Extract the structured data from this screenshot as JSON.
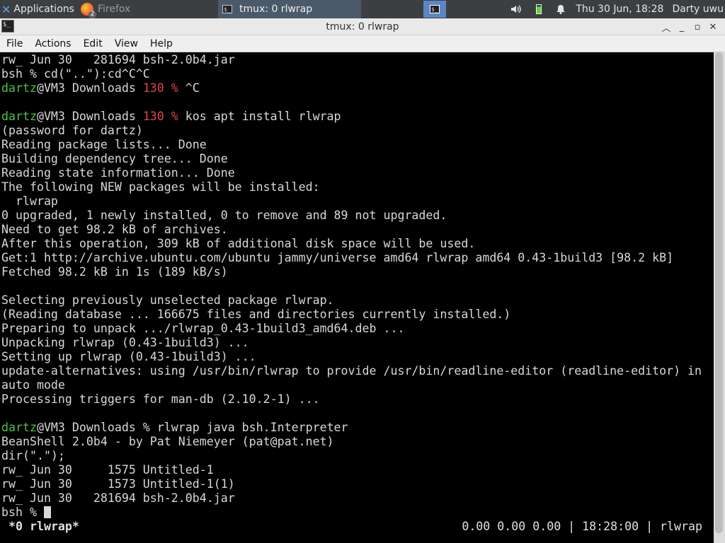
{
  "panel": {
    "apps_label": "Applications",
    "firefox_label": "Firefox",
    "firefox_badge": "2",
    "tmux_task_label": "tmux: 0 rlwrap",
    "clock": "Thu 30 Jun, 18:28",
    "user": "Darty uwu"
  },
  "window": {
    "title": "tmux: 0 rlwrap"
  },
  "menu": {
    "file": "File",
    "actions": "Actions",
    "edit": "Edit",
    "view": "View",
    "help": "Help"
  },
  "terminal": {
    "line1": "rw_ Jun 30   281694 bsh-2.0b4.jar",
    "line2": "bsh % cd(\"..\"):cd^C^C",
    "line3_user": "dartz",
    "line3_host": "@VM3 Downloads ",
    "line3_code": "130 %",
    "line3_cmd": " ^C",
    "line5_user": "dartz",
    "line5_host": "@VM3 Downloads ",
    "line5_code": "130 %",
    "line5_cmd": " kos apt install rlwrap",
    "line6": "(password for dartz)",
    "line7": "Reading package lists... Done",
    "line8": "Building dependency tree... Done",
    "line9": "Reading state information... Done",
    "line10": "The following NEW packages will be installed:",
    "line11": "  rlwrap",
    "line12": "0 upgraded, 1 newly installed, 0 to remove and 89 not upgraded.",
    "line13": "Need to get 98.2 kB of archives.",
    "line14": "After this operation, 309 kB of additional disk space will be used.",
    "line15": "Get:1 http://archive.ubuntu.com/ubuntu jammy/universe amd64 rlwrap amd64 0.43-1build3 [98.2 kB]",
    "line16": "Fetched 98.2 kB in 1s (189 kB/s)",
    "line18": "Selecting previously unselected package rlwrap.",
    "line19": "(Reading database ... 166675 files and directories currently installed.)",
    "line20": "Preparing to unpack .../rlwrap_0.43-1build3_amd64.deb ...",
    "line21": "Unpacking rlwrap (0.43-1build3) ...",
    "line22": "Setting up rlwrap (0.43-1build3) ...",
    "line23": "update-alternatives: using /usr/bin/rlwrap to provide /usr/bin/readline-editor (readline-editor) in",
    "line24": "auto mode",
    "line25": "Processing triggers for man-db (2.10.2-1) ...",
    "line27_user": "dartz",
    "line27_host": "@VM3 Downloads % ",
    "line27_cmd": "rlwrap java bsh.Interpreter",
    "line28": "BeanShell 2.0b4 - by Pat Niemeyer (pat@pat.net)",
    "line29": "dir(\".\");",
    "line30": "rw_ Jun 30     1575 Untitled-1",
    "line31": "rw_ Jun 30     1573 Untitled-1(1)",
    "line32": "rw_ Jun 30   281694 bsh-2.0b4.jar",
    "line33": "bsh % "
  },
  "status": {
    "left": "*0 rlwrap*",
    "right": "0.00 0.00 0.00 | 18:28:00 | rlwrap"
  }
}
